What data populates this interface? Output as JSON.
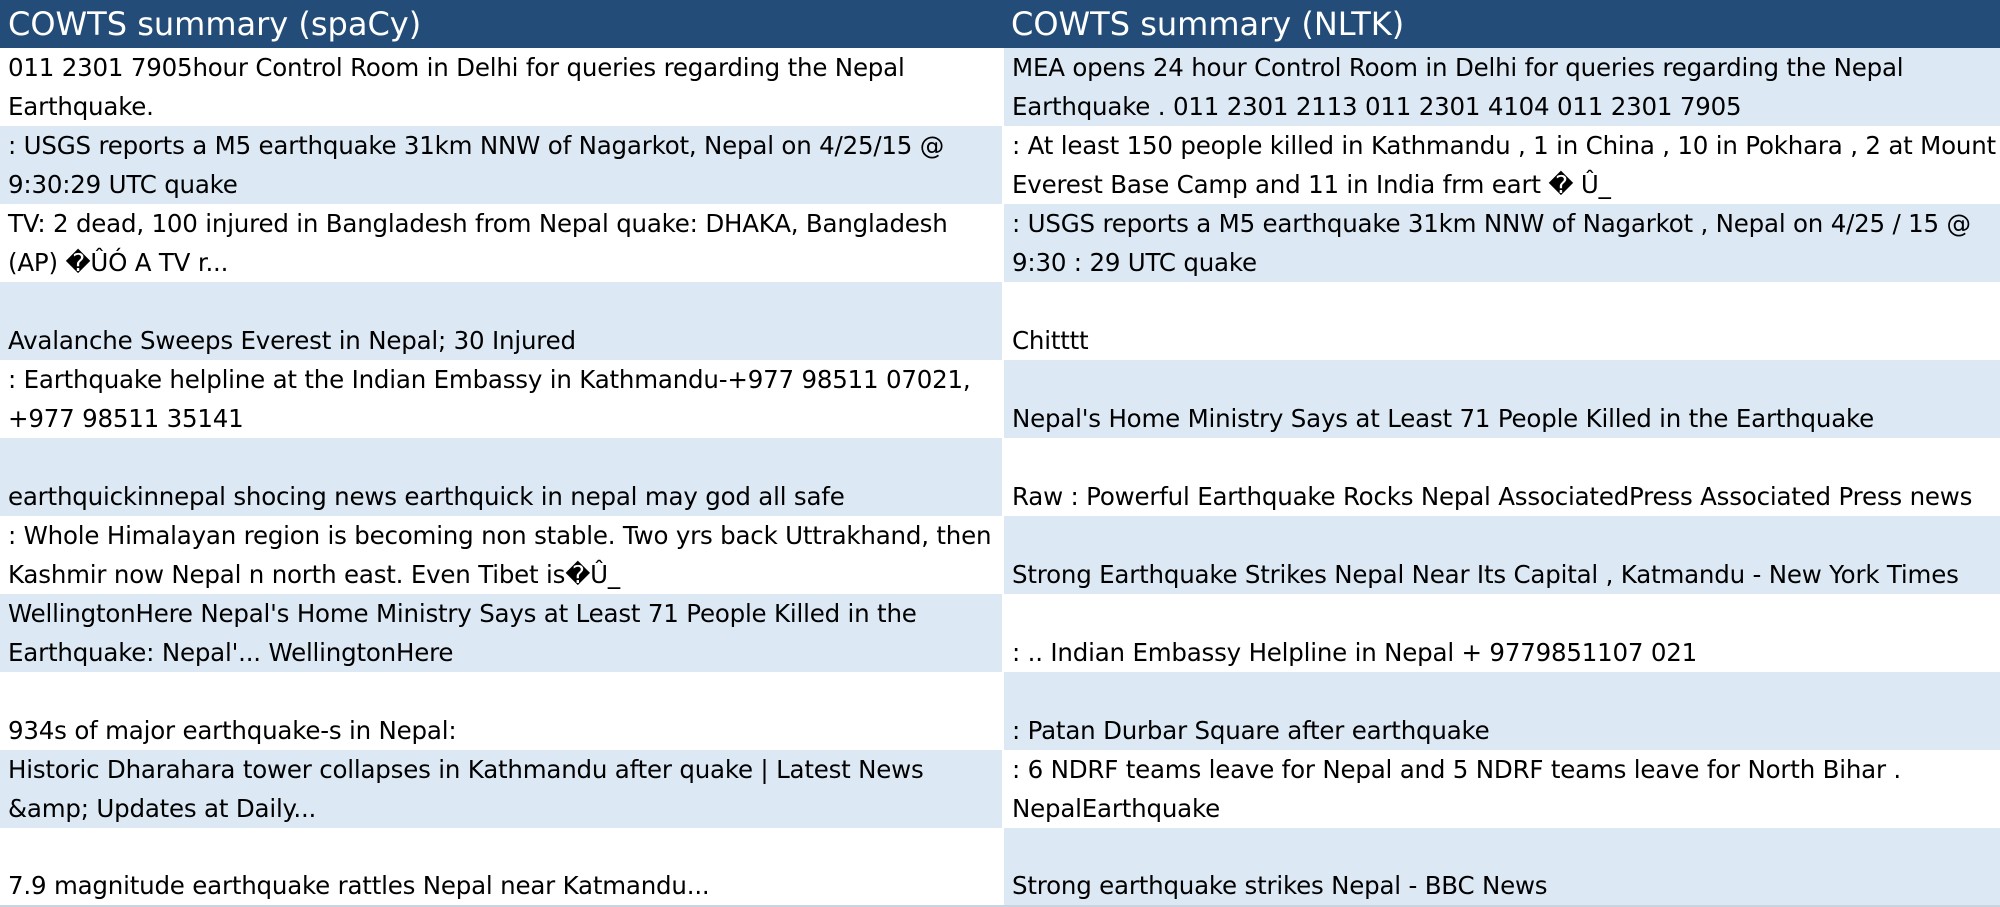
{
  "headers": [
    "COWTS summary (spaCy)",
    "COWTS summary (NLTK)"
  ],
  "colors": {
    "header_bg": "#234d78",
    "header_text": "#ffffff",
    "band_blue": "#dce9f5",
    "band_white": "#ffffff"
  },
  "rows": [
    {
      "left": "011 2301 7905hour Control Room in Delhi for queries regarding the Nepal Earthquake.",
      "right": "MEA opens 24 hour Control Room in Delhi for queries regarding the Nepal Earthquake . 011 2301 2113 011 2301 4104 011 2301 7905",
      "left_bg": "white",
      "right_bg": "blue"
    },
    {
      "left": ": USGS reports a M5 earthquake 31km NNW of Nagarkot, Nepal on 4/25/15 @ 9:30:29 UTC  quake",
      "right": ": At least 150 people killed in Kathmandu , 1 in China , 10 in Pokhara , 2 at Mount Everest Base Camp and 11 in India frm eart � Û_",
      "left_bg": "blue",
      "right_bg": "white"
    },
    {
      "left": "TV: 2 dead, 100 injured in Bangladesh from Nepal quake: DHAKA, Bangladesh (AP) �ÛÓ A TV r...",
      "right": ": USGS reports a M5 earthquake 31km NNW of Nagarkot , Nepal on 4/25 / 15 @ 9:30 : 29 UTC quake",
      "left_bg": "white",
      "right_bg": "blue"
    },
    {
      "left": "Avalanche Sweeps Everest in Nepal; 30 Injured",
      "right": "Chitttt",
      "left_bg": "blue",
      "right_bg": "white"
    },
    {
      "left": ": Earthquake helpline at the Indian Embassy in Kathmandu-+977 98511 07021, +977 98511 35141",
      "right": "Nepal's Home Ministry Says at Least 71 People Killed in the Earthquake",
      "left_bg": "white",
      "right_bg": "blue"
    },
    {
      "left": "earthquickinnepal shocing news earthquick in nepal may god all safe",
      "right": "Raw : Powerful Earthquake Rocks Nepal AssociatedPress Associated Press news",
      "left_bg": "blue",
      "right_bg": "white"
    },
    {
      "left": ": Whole Himalayan region is becoming non stable. Two yrs back Uttrakhand, then Kashmir now Nepal n north east. Even Tibet is�Û_",
      "right": "Strong Earthquake Strikes Nepal Near Its Capital , Katmandu - New York Times",
      "left_bg": "white",
      "right_bg": "blue"
    },
    {
      "left": "WellingtonHere Nepal's Home Ministry Says at Least 71 People Killed in the Earthquake: Nepal'...  WellingtonHere",
      "right": ": .. Indian Embassy Helpline in Nepal + 9779851107 021",
      "left_bg": "blue",
      "right_bg": "white"
    },
    {
      "left": "934s of major earthquake-s in Nepal:",
      "right": ": Patan Durbar Square after earthquake",
      "left_bg": "white",
      "right_bg": "blue"
    },
    {
      "left": "Historic Dharahara tower collapses in Kathmandu after quake | Latest News &amp; Updates at Daily...",
      "right": ": 6 NDRF teams leave for Nepal and 5 NDRF teams leave for North Bihar . NepalEarthquake",
      "left_bg": "blue",
      "right_bg": "white"
    },
    {
      "left": "7.9 magnitude earthquake rattles Nepal near Katmandu...",
      "right": "Strong earthquake strikes Nepal - BBC News",
      "left_bg": "white",
      "right_bg": "blue"
    }
  ]
}
